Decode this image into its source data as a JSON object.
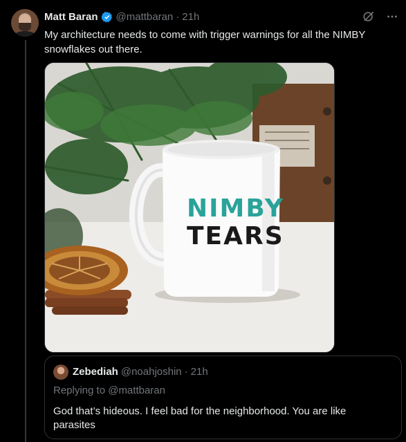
{
  "tweet": {
    "author_name": "Matt Baran",
    "handle": "@mattbaran",
    "separator": "·",
    "time": "21h",
    "text": "My architecture needs to come with trigger warnings for all the NIMBY snowflakes out there.",
    "mug_line1": "NIMBY",
    "mug_line2": "TEARS"
  },
  "quote": {
    "author_name": "Zebediah",
    "handle": "@noahjoshin",
    "separator": "·",
    "time": "21h",
    "replying": "Replying to @mattbaran",
    "text": "God that’s hideous. I feel bad for the neighborhood. You are like parasites"
  },
  "colors": {
    "background": "#000000",
    "primary_text": "#e7e9ea",
    "secondary_text": "#71767b",
    "verified": "#1d9bf0",
    "mug_teal": "#2aa39a",
    "mug_black": "#1a1a1a"
  },
  "icons": [
    "verified-badge-icon",
    "grok-icon",
    "more-icon"
  ]
}
